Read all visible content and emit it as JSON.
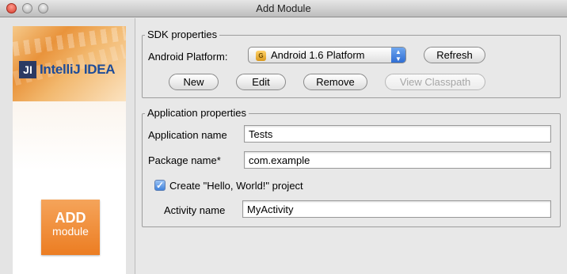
{
  "window": {
    "title": "Add Module"
  },
  "banner": {
    "logo_mark": "JI",
    "logo_text": "IntelliJ IDEA",
    "tile_line1": "ADD",
    "tile_line2": "module"
  },
  "sdk": {
    "group_title": "SDK properties",
    "platform_label": "Android Platform:",
    "platform_value": "Android 1.6 Platform",
    "platform_icon": "android-sdk-icon",
    "refresh_label": "Refresh",
    "new_label": "New",
    "edit_label": "Edit",
    "remove_label": "Remove",
    "view_classpath_label": "View Classpath"
  },
  "app": {
    "group_title": "Application properties",
    "app_name_label": "Application name",
    "app_name_value": "Tests",
    "package_label": "Package name*",
    "package_value": "com.example",
    "create_label": "Create \"Hello, World!\" project",
    "create_checked": true,
    "activity_label": "Activity name",
    "activity_value": "MyActivity"
  }
}
